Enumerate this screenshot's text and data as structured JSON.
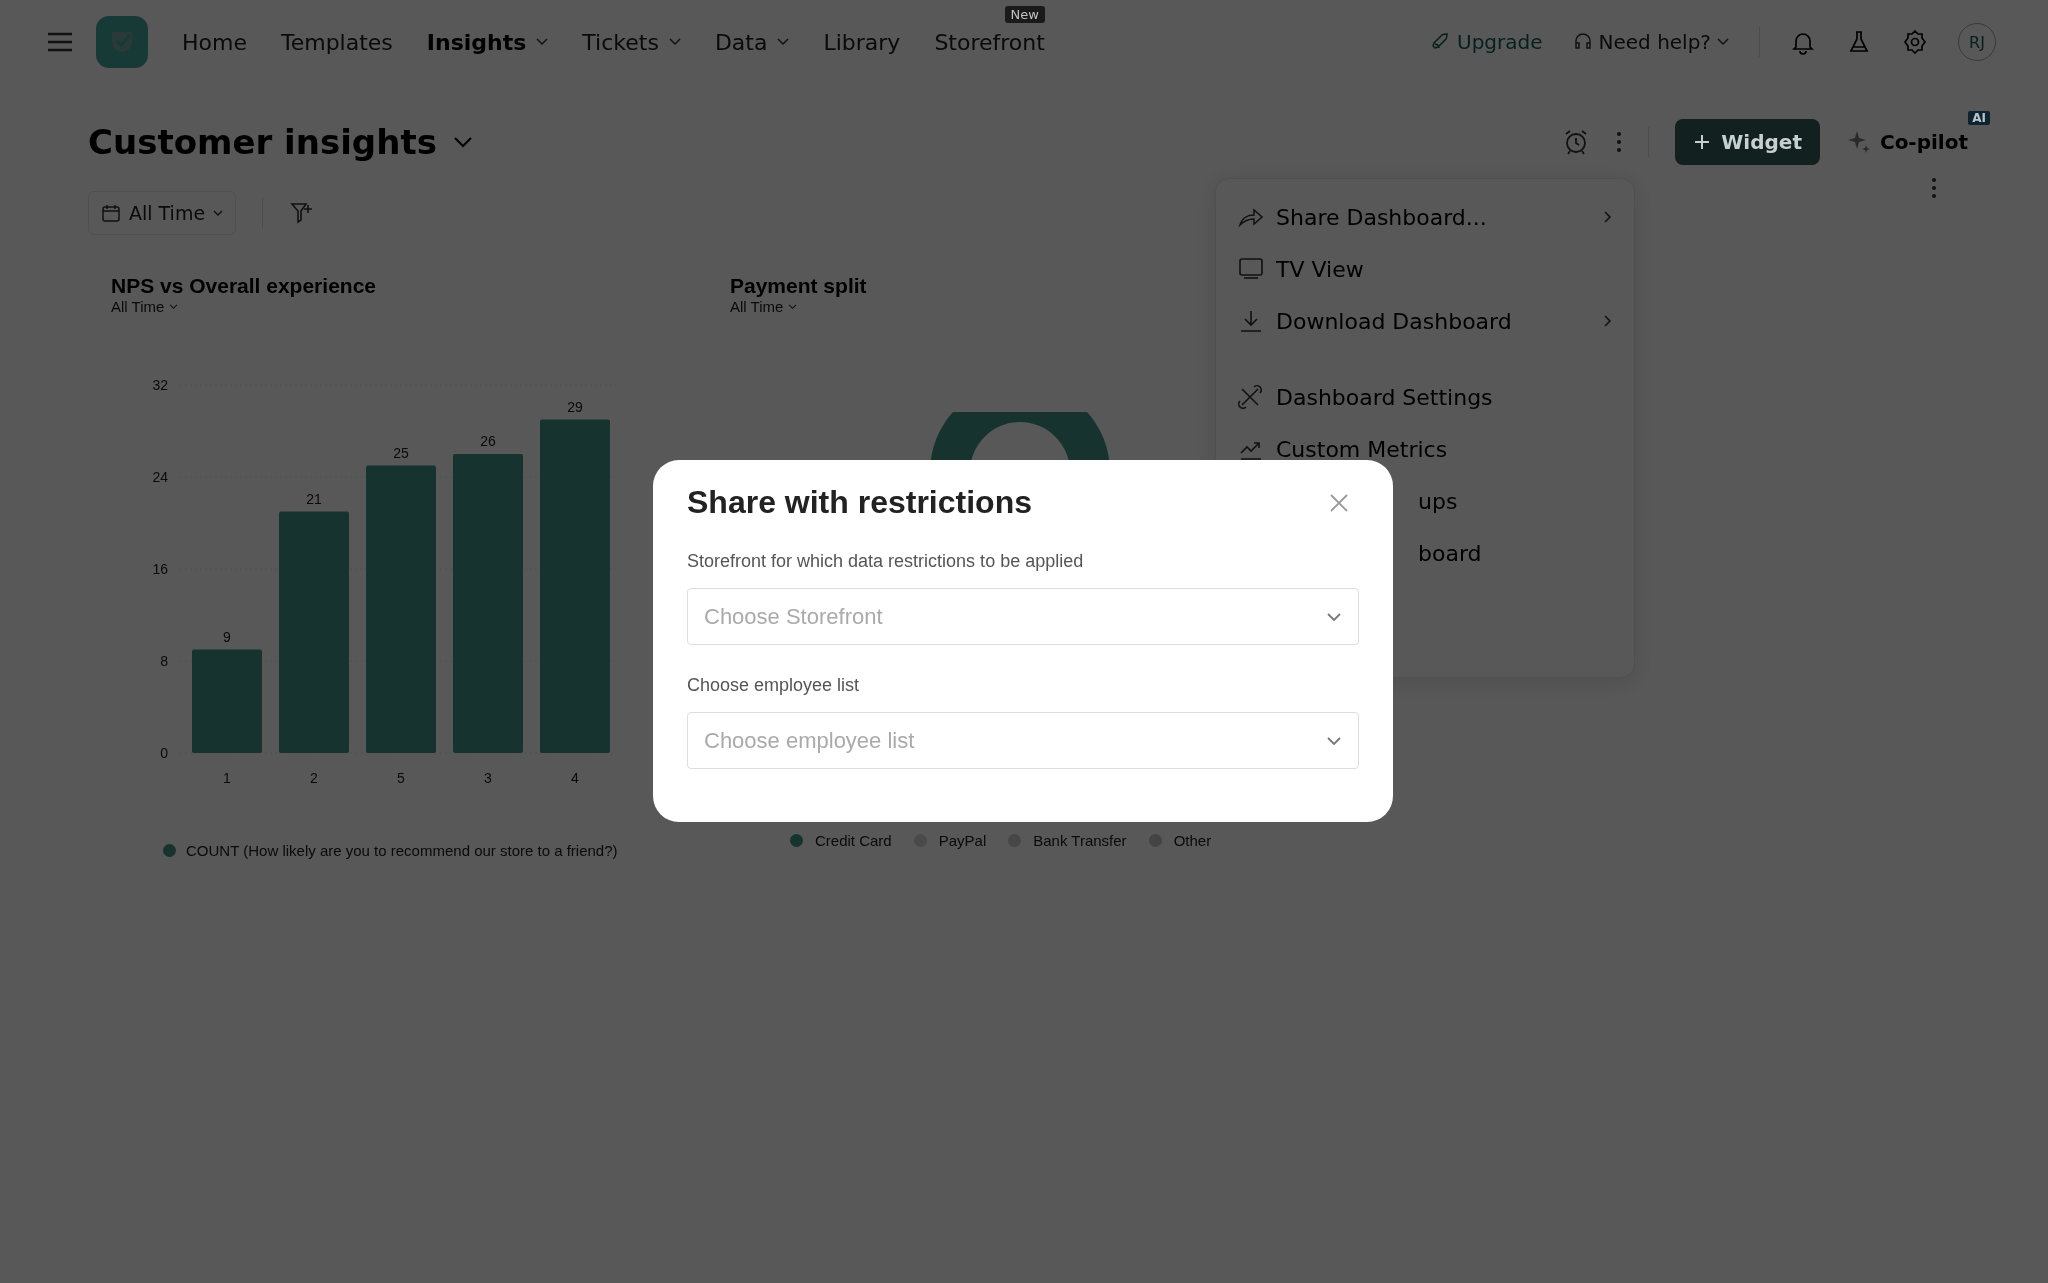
{
  "nav": {
    "items": [
      {
        "label": "Home",
        "selected": false,
        "dropdown": false
      },
      {
        "label": "Templates",
        "selected": false,
        "dropdown": false
      },
      {
        "label": "Insights",
        "selected": true,
        "dropdown": true
      },
      {
        "label": "Tickets",
        "selected": false,
        "dropdown": true
      },
      {
        "label": "Data",
        "selected": false,
        "dropdown": true
      },
      {
        "label": "Library",
        "selected": false,
        "dropdown": false
      },
      {
        "label": "Storefront",
        "selected": false,
        "dropdown": false,
        "badge": "New"
      }
    ],
    "upgrade": "Upgrade",
    "help": "Need help?",
    "avatar": "RJ"
  },
  "header": {
    "title": "Customer insights",
    "widget_button": "Widget",
    "copilot": "Co-pilot",
    "copilot_badge": "AI",
    "filter": "All Time"
  },
  "widgets": [
    {
      "kind": "bar",
      "title": "NPS vs Overall experience",
      "filter": "All Time",
      "chart_data": {
        "type": "bar",
        "categories": [
          "1",
          "2",
          "5",
          "3",
          "4"
        ],
        "series": [
          {
            "name": "COUNT (How likely are you to recommend our store to a friend?)",
            "color": "#16332f",
            "values": [
              9,
              21,
              25,
              26,
              29
            ]
          }
        ],
        "ylim": [
          0,
          32
        ],
        "yticks": [
          0,
          8,
          16,
          24,
          32
        ],
        "data_labels": true
      }
    },
    {
      "kind": "donut",
      "title": "Payment split",
      "filter": "All Time",
      "legend": [
        {
          "label": "Credit Card",
          "color": "#16332f"
        },
        {
          "label": "PayPal",
          "color": "#4a4a4a"
        },
        {
          "label": "Bank Transfer",
          "color": "#474747"
        },
        {
          "label": "Other",
          "color": "#444444"
        }
      ]
    }
  ],
  "menu": {
    "groups": [
      {
        "items": [
          {
            "label": "Share Dashboard...",
            "submenu": true
          },
          {
            "label": "TV View",
            "submenu": false
          },
          {
            "label": "Download Dashboard",
            "submenu": true
          }
        ]
      },
      {
        "items": [
          {
            "label": "Dashboard Settings",
            "submenu": false
          },
          {
            "label": "Custom Metrics",
            "submenu": false
          }
        ],
        "covered_items": [
          "ups",
          "board"
        ]
      }
    ]
  },
  "modal": {
    "title": "Share with restrictions",
    "fields": [
      {
        "label": "Storefront for which data restrictions to be applied",
        "placeholder": "Choose Storefront"
      },
      {
        "label": "Choose employee list",
        "placeholder": "Choose employee list"
      }
    ]
  }
}
